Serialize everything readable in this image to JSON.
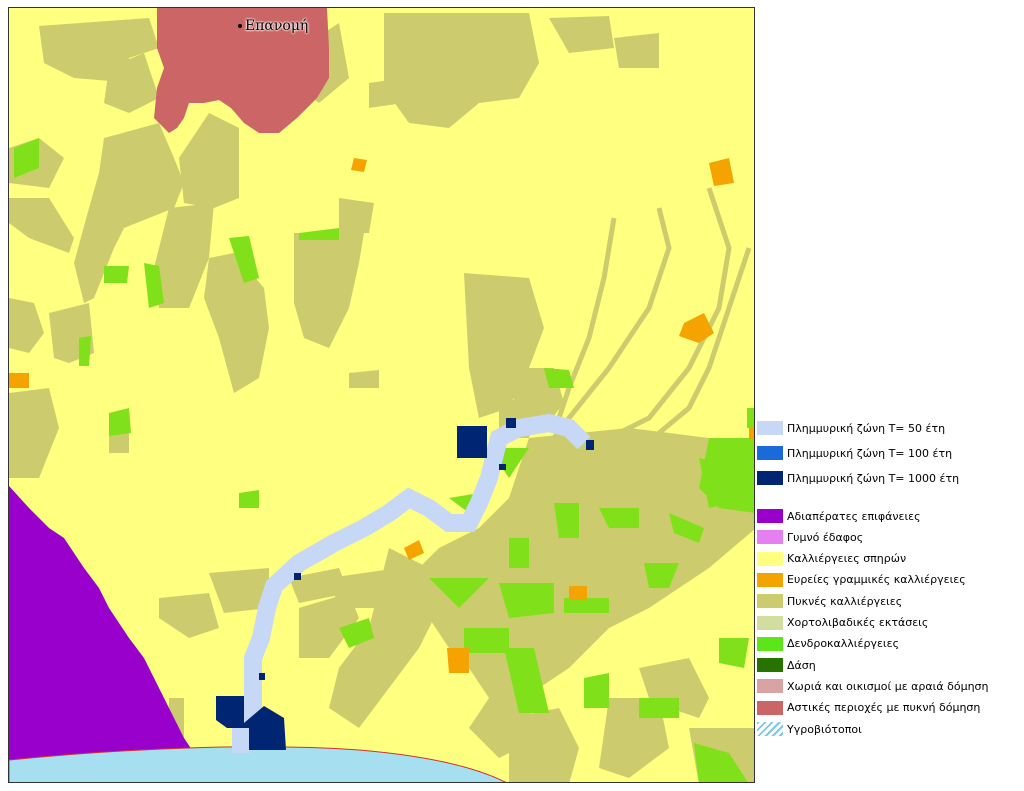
{
  "map": {
    "place_label": "Επανομή",
    "colors": {
      "background": "#ffff80",
      "dense_crops": "#cccc6e",
      "tree_crops": "#80e01a",
      "wide_crops": "#f5a300",
      "urban_dense": "#cc6666",
      "impervious": "#9900cc",
      "sea": "#a6dff0",
      "flood_50": "#c6d8f5",
      "flood_1000": "#002673"
    }
  },
  "legend": {
    "flood": [
      {
        "label": "Πλημμυρική ζώνη Τ= 50 έτη",
        "color": "#c6d8f5"
      },
      {
        "label": "Πλημμυρική ζώνη Τ= 100 έτη",
        "color": "#1a6bd9"
      },
      {
        "label": "Πλημμυρική ζώνη Τ= 1000 έτη",
        "color": "#002673"
      }
    ],
    "landuse": [
      {
        "label": "Αδιαπέρατες επιφάνειες",
        "color": "#9900cc"
      },
      {
        "label": "Γυμνό έδαφος",
        "color": "#e680f0"
      },
      {
        "label": "Καλλιέργειες σπηρών",
        "color": "#ffff80"
      },
      {
        "label": "Ευρείες γραμμικές καλλιέργειες",
        "color": "#f5a300"
      },
      {
        "label": "Πυκνές καλλιέργειες",
        "color": "#cccc6e"
      },
      {
        "label": "Χορτολιβαδικές εκτάσεις",
        "color": "#d2dea0"
      },
      {
        "label": "Δενδροκαλλιέργειες",
        "color": "#5ce61a"
      },
      {
        "label": "Δάση",
        "color": "#267300"
      },
      {
        "label": "Χωριά και οικισμοί με αραιά δόμηση",
        "color": "#d9a3a3"
      },
      {
        "label": "Αστικές περιοχές με πυκνή δόμηση",
        "color": "#cc6666"
      },
      {
        "label": "Υγροβιότοποι",
        "color": "hatch"
      }
    ]
  }
}
